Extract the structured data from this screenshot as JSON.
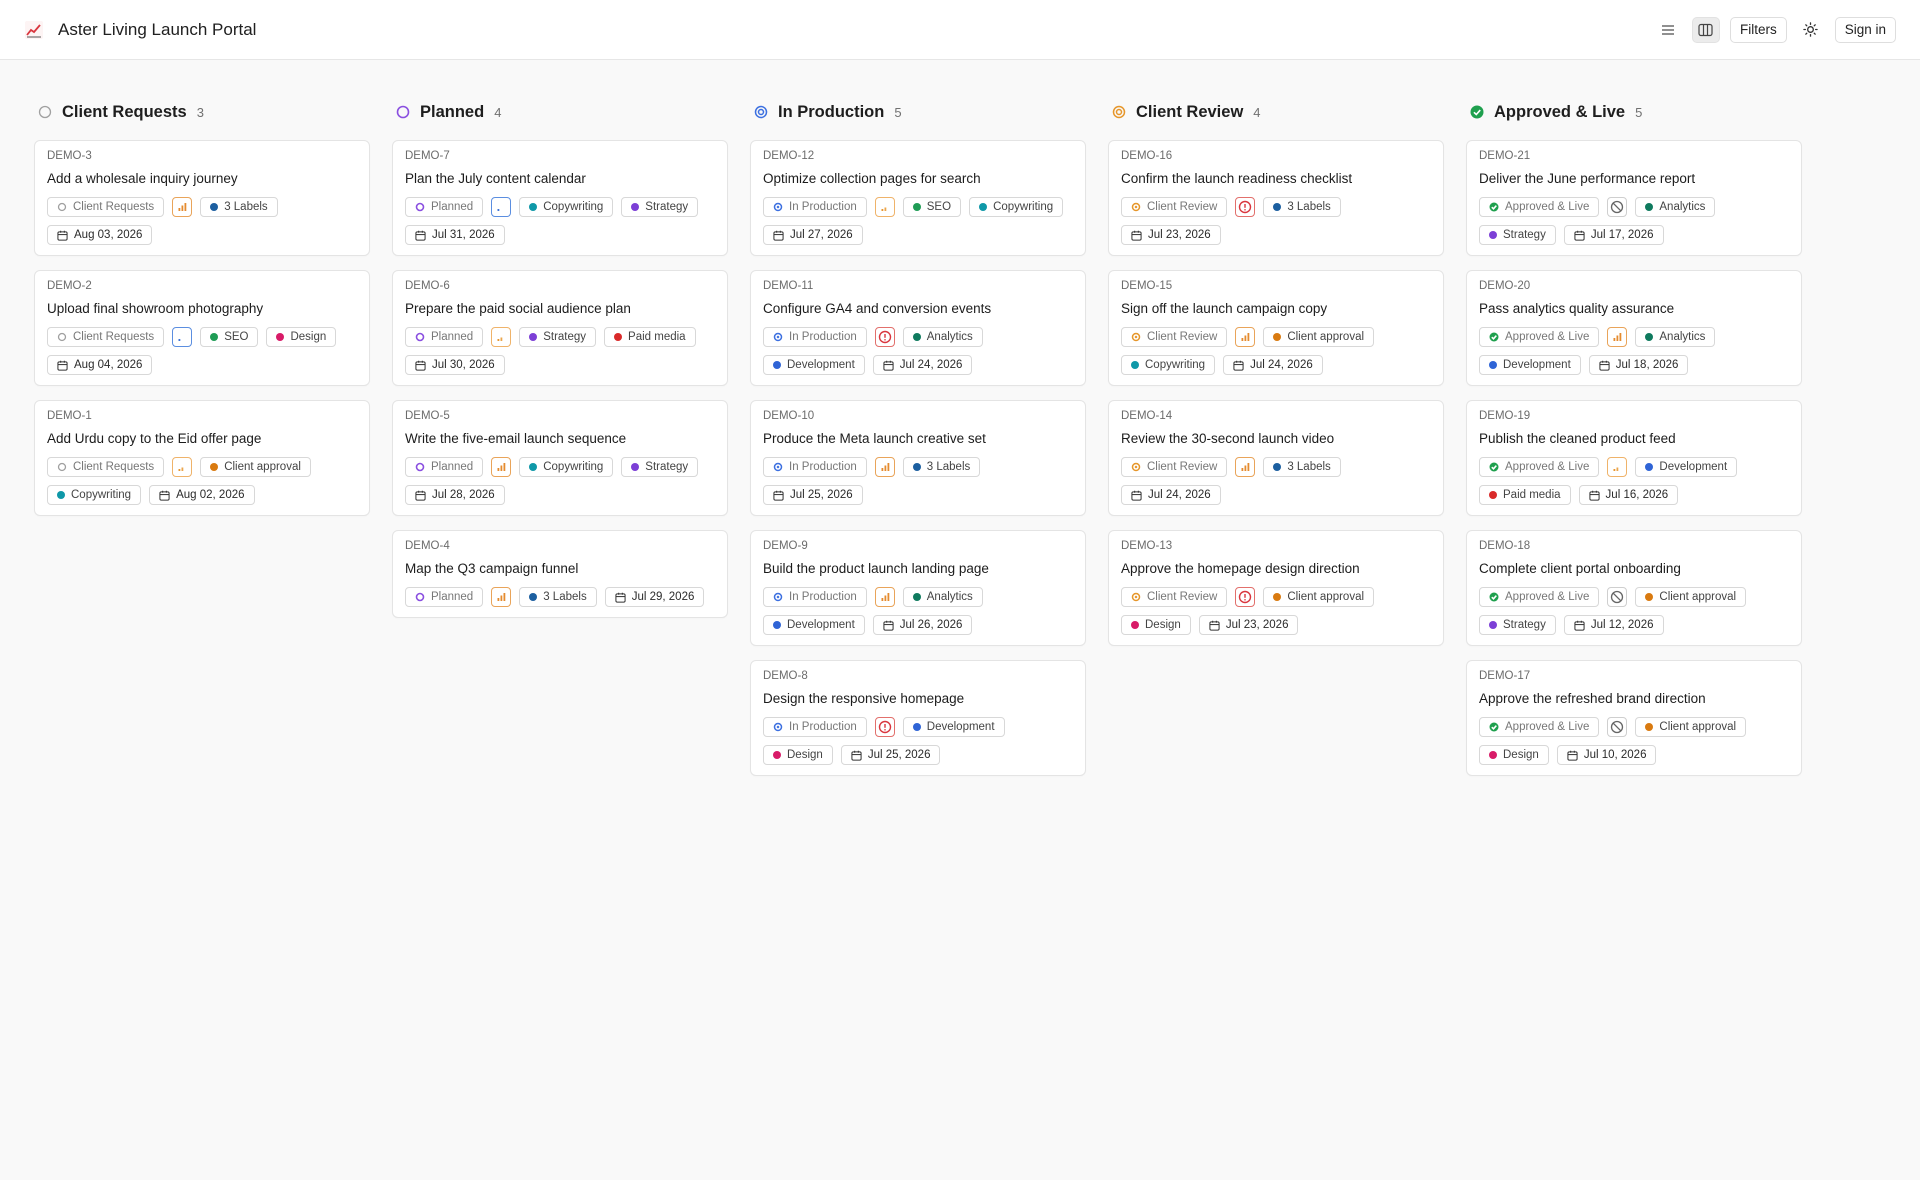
{
  "app": {
    "title": "Aster Living Launch Portal"
  },
  "toolbar": {
    "filters_label": "Filters",
    "signin_label": "Sign in"
  },
  "colors": {
    "Client approval": "#d97a10",
    "Copywriting": "#0f98a8",
    "SEO": "#1f9c55",
    "Design": "#d81b68",
    "Strategy": "#7c3fd6",
    "Paid media": "#d92a2a",
    "Analytics": "#0f7a5e",
    "Development": "#2f64d6",
    "3 Labels": "#1c5fa0"
  },
  "columns": [
    {
      "key": "client-requests",
      "title": "Client Requests",
      "count": "3",
      "icon": "circle-empty-icon",
      "cards": [
        {
          "id": "DEMO-3",
          "title": "Add a wholesale inquiry journey",
          "status": "Client Requests",
          "priority": "high",
          "labels": [
            "3 Labels"
          ],
          "date": "Aug 03, 2026"
        },
        {
          "id": "DEMO-2",
          "title": "Upload final showroom photography",
          "status": "Client Requests",
          "priority": "low",
          "labels": [
            "SEO",
            "Design"
          ],
          "date": "Aug 04, 2026"
        },
        {
          "id": "DEMO-1",
          "title": "Add Urdu copy to the Eid offer page",
          "status": "Client Requests",
          "priority": "med",
          "labels": [
            "Client approval",
            "Copywriting"
          ],
          "date": "Aug 02, 2026"
        }
      ]
    },
    {
      "key": "planned",
      "title": "Planned",
      "count": "4",
      "icon": "circle-planned-icon",
      "cards": [
        {
          "id": "DEMO-7",
          "title": "Plan the July content calendar",
          "status": "Planned",
          "priority": "low",
          "labels": [
            "Copywriting",
            "Strategy"
          ],
          "date": "Jul 31, 2026"
        },
        {
          "id": "DEMO-6",
          "title": "Prepare the paid social audience plan",
          "status": "Planned",
          "priority": "med",
          "labels": [
            "Strategy",
            "Paid media"
          ],
          "date": "Jul 30, 2026"
        },
        {
          "id": "DEMO-5",
          "title": "Write the five-email launch sequence",
          "status": "Planned",
          "priority": "high",
          "labels": [
            "Copywriting",
            "Strategy"
          ],
          "date": "Jul 28, 2026"
        },
        {
          "id": "DEMO-4",
          "title": "Map the Q3 campaign funnel",
          "status": "Planned",
          "priority": "high",
          "labels": [
            "3 Labels"
          ],
          "date": "Jul 29, 2026"
        }
      ]
    },
    {
      "key": "in-production",
      "title": "In Production",
      "count": "5",
      "icon": "in-production-icon",
      "cards": [
        {
          "id": "DEMO-12",
          "title": "Optimize collection pages for search",
          "status": "In Production",
          "priority": "med",
          "labels": [
            "SEO",
            "Copywriting"
          ],
          "date": "Jul 27, 2026"
        },
        {
          "id": "DEMO-11",
          "title": "Configure GA4 and conversion events",
          "status": "In Production",
          "priority": "urgent",
          "labels": [
            "Analytics",
            "Development"
          ],
          "date": "Jul 24, 2026"
        },
        {
          "id": "DEMO-10",
          "title": "Produce the Meta launch creative set",
          "status": "In Production",
          "priority": "high",
          "labels": [
            "3 Labels"
          ],
          "date": "Jul 25, 2026"
        },
        {
          "id": "DEMO-9",
          "title": "Build the product launch landing page",
          "status": "In Production",
          "priority": "high",
          "labels": [
            "Analytics",
            "Development"
          ],
          "date": "Jul 26, 2026"
        },
        {
          "id": "DEMO-8",
          "title": "Design the responsive homepage",
          "status": "In Production",
          "priority": "urgent",
          "labels": [
            "Development",
            "Design"
          ],
          "date": "Jul 25, 2026"
        }
      ]
    },
    {
      "key": "client-review",
      "title": "Client Review",
      "count": "4",
      "icon": "client-review-icon",
      "cards": [
        {
          "id": "DEMO-16",
          "title": "Confirm the launch readiness checklist",
          "status": "Client Review",
          "priority": "urgent",
          "labels": [
            "3 Labels"
          ],
          "date": "Jul 23, 2026"
        },
        {
          "id": "DEMO-15",
          "title": "Sign off the launch campaign copy",
          "status": "Client Review",
          "priority": "high",
          "labels": [
            "Client approval",
            "Copywriting"
          ],
          "date": "Jul 24, 2026"
        },
        {
          "id": "DEMO-14",
          "title": "Review the 30-second launch video",
          "status": "Client Review",
          "priority": "high",
          "labels": [
            "3 Labels"
          ],
          "date": "Jul 24, 2026"
        },
        {
          "id": "DEMO-13",
          "title": "Approve the homepage design direction",
          "status": "Client Review",
          "priority": "urgent",
          "labels": [
            "Client approval",
            "Design"
          ],
          "date": "Jul 23, 2026"
        }
      ]
    },
    {
      "key": "approved-live",
      "title": "Approved & Live",
      "count": "5",
      "icon": "check-circle-icon",
      "cards": [
        {
          "id": "DEMO-21",
          "title": "Deliver the June performance report",
          "status": "Approved & Live",
          "priority": "none",
          "labels": [
            "Analytics",
            "Strategy"
          ],
          "date": "Jul 17, 2026"
        },
        {
          "id": "DEMO-20",
          "title": "Pass analytics quality assurance",
          "status": "Approved & Live",
          "priority": "high",
          "labels": [
            "Analytics",
            "Development"
          ],
          "date": "Jul 18, 2026"
        },
        {
          "id": "DEMO-19",
          "title": "Publish the cleaned product feed",
          "status": "Approved & Live",
          "priority": "med",
          "labels": [
            "Development",
            "Paid media"
          ],
          "date": "Jul 16, 2026"
        },
        {
          "id": "DEMO-18",
          "title": "Complete client portal onboarding",
          "status": "Approved & Live",
          "priority": "none",
          "labels": [
            "Client approval",
            "Strategy"
          ],
          "date": "Jul 12, 2026"
        },
        {
          "id": "DEMO-17",
          "title": "Approve the refreshed brand direction",
          "status": "Approved & Live",
          "priority": "none",
          "labels": [
            "Client approval",
            "Design"
          ],
          "date": "Jul 10, 2026"
        }
      ]
    }
  ]
}
